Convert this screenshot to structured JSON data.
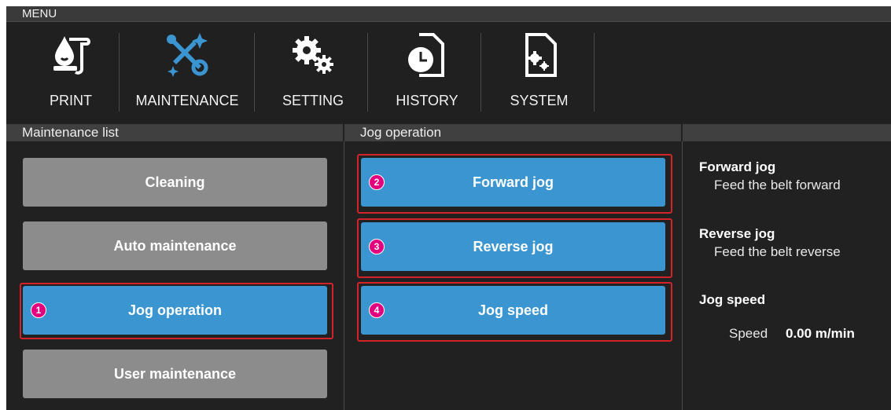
{
  "menu": {
    "title": "MENU",
    "items": [
      {
        "label": "PRINT",
        "icon": "print-icon"
      },
      {
        "label": "MAINTENANCE",
        "icon": "maintenance-icon"
      },
      {
        "label": "SETTING",
        "icon": "gears-icon"
      },
      {
        "label": "HISTORY",
        "icon": "history-icon"
      },
      {
        "label": "SYSTEM",
        "icon": "system-icon"
      }
    ]
  },
  "maintenance_list": {
    "header": "Maintenance list",
    "buttons": [
      "Cleaning",
      "Auto maintenance",
      "Jog operation",
      "User maintenance"
    ],
    "selected": "Jog operation",
    "marker": "1"
  },
  "jog_operation": {
    "header": "Jog operation",
    "buttons": [
      {
        "label": "Forward jog",
        "marker": "2"
      },
      {
        "label": "Reverse jog",
        "marker": "3"
      },
      {
        "label": "Jog speed",
        "marker": "4"
      }
    ]
  },
  "info": {
    "forward_title": "Forward jog",
    "forward_desc": "Feed the belt forward",
    "reverse_title": "Reverse jog",
    "reverse_desc": "Feed the belt reverse",
    "speed_title": "Jog speed",
    "speed_label": "Speed",
    "speed_value": "0.00 m/min"
  },
  "colors": {
    "accent_blue": "#3a95d0",
    "gray_button": "#8c8c8c",
    "highlight_red": "#d2232a",
    "marker_magenta": "#e3007f",
    "background": "#212121"
  }
}
